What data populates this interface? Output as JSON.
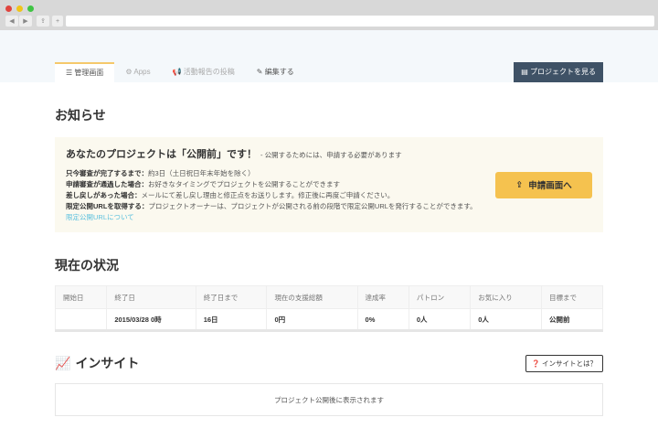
{
  "browser": {
    "back": "◀",
    "forward": "▶",
    "share": "⇪",
    "newtab": "+"
  },
  "tabs": [
    {
      "icon": "☰",
      "label": "管理画面"
    },
    {
      "icon": "⚙",
      "label": "Apps"
    },
    {
      "icon": "📢",
      "label": "活動報告の投稿"
    },
    {
      "icon": "✎",
      "label": "編集する"
    }
  ],
  "view_project": "プロジェクトを見る",
  "notice": {
    "heading": "お知らせ",
    "title": "あなたのプロジェクトは「公開前」です！",
    "subtitle": "- 公開するためには、申請する必要があります",
    "lines": [
      {
        "k": "只今審査が完了するまで：",
        "v": "約3日（土日祝日年末年始を除く）"
      },
      {
        "k": "申請審査が通過した場合：",
        "v": "お好きなタイミングでプロジェクトを公開することができます"
      },
      {
        "k": "差し戻しがあった場合：",
        "v": "メールにて差し戻し理由と修正点をお送りします。修正後に再度ご申請ください。"
      },
      {
        "k": "限定公開URLを取得する：",
        "v": "プロジェクトオーナーは、プロジェクトが公開される前の段階で限定公開URLを発行することができます。"
      }
    ],
    "link": "限定公開URLについて",
    "apply": "申請画面へ"
  },
  "status": {
    "heading": "現在の状況",
    "headers": [
      "開始日",
      "終了日",
      "終了日まで",
      "現在の支援総額",
      "達成率",
      "パトロン",
      "お気に入り",
      "目標まで"
    ],
    "values": [
      "",
      "2015/03/28 0時",
      "16日",
      "0円",
      "0%",
      "0人",
      "0人",
      "公開前"
    ]
  },
  "insight": {
    "heading": "インサイト",
    "help": "インサイトとは？",
    "empty": "プロジェクト公開後に表示されます"
  }
}
